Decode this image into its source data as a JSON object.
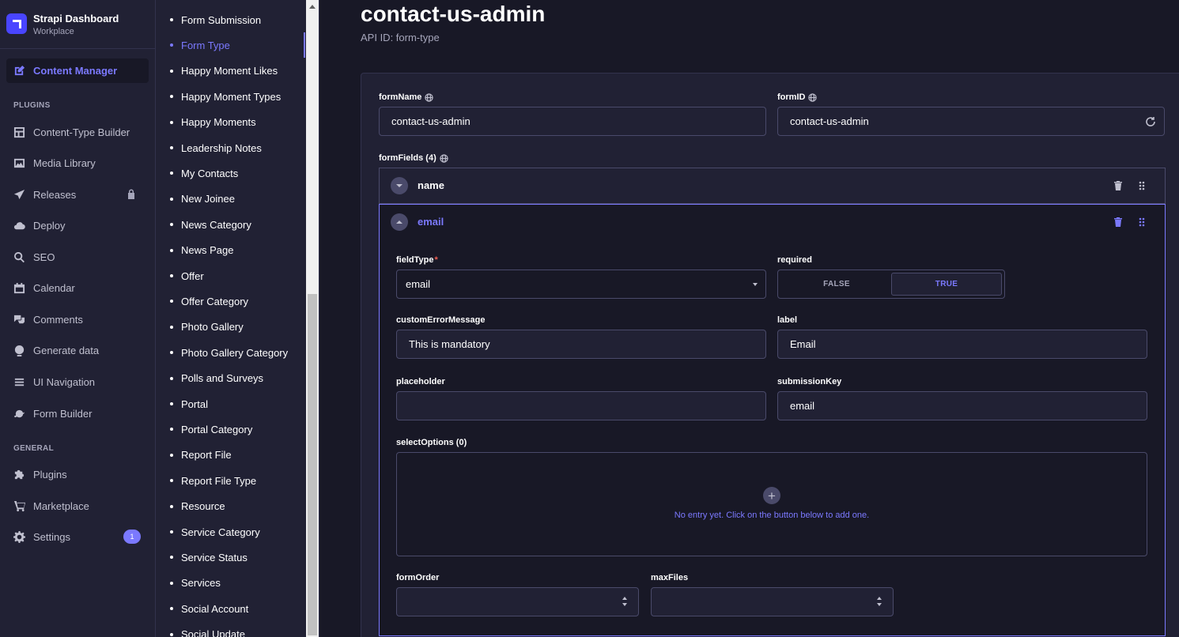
{
  "brand": {
    "title": "Strapi Dashboard",
    "subtitle": "Workplace"
  },
  "nav": {
    "content_manager": "Content Manager",
    "plugins_heading": "PLUGINS",
    "content_type_builder": "Content-Type Builder",
    "media_library": "Media Library",
    "releases": "Releases",
    "deploy": "Deploy",
    "seo": "SEO",
    "calendar": "Calendar",
    "comments": "Comments",
    "generate_data": "Generate data",
    "ui_navigation": "UI Navigation",
    "form_builder": "Form Builder",
    "general_heading": "GENERAL",
    "plugins": "Plugins",
    "marketplace": "Marketplace",
    "settings": "Settings",
    "settings_badge": "1"
  },
  "sub_nav": {
    "items": [
      "Form Submission",
      "Form Type",
      "Happy Moment Likes",
      "Happy Moment Types",
      "Happy Moments",
      "Leadership Notes",
      "My Contacts",
      "New Joinee",
      "News Category",
      "News Page",
      "Offer",
      "Offer Category",
      "Photo Gallery",
      "Photo Gallery Category",
      "Polls and Surveys",
      "Portal",
      "Portal Category",
      "Report File",
      "Report File Type",
      "Resource",
      "Service Category",
      "Service Status",
      "Services",
      "Social Account",
      "Social Update"
    ],
    "active": "Form Type"
  },
  "header": {
    "title": "contact-us-admin",
    "api_id": "API ID: form-type"
  },
  "form": {
    "form_name_label": "formName",
    "form_name_value": "contact-us-admin",
    "form_id_label": "formID",
    "form_id_value": "contact-us-admin",
    "form_fields_label": "formFields (4)",
    "rows": [
      {
        "title": "name"
      },
      {
        "title": "email"
      }
    ],
    "field_type_label": "fieldType",
    "field_type_required_mark": "*",
    "field_type_value": "email",
    "required_label": "required",
    "required_false": "FALSE",
    "required_true": "TRUE",
    "custom_error_label": "customErrorMessage",
    "custom_error_value": "This is mandatory",
    "label_label": "label",
    "label_value": "Email",
    "placeholder_label": "placeholder",
    "placeholder_value": "",
    "submission_key_label": "submissionKey",
    "submission_key_value": "email",
    "select_options_label": "selectOptions (0)",
    "select_options_empty": "No entry yet. Click on the button below to add one.",
    "form_order_label": "formOrder",
    "max_files_label": "maxFiles"
  },
  "colors": {
    "accent": "#7b79ff",
    "background": "#181826",
    "panel": "#212134",
    "border": "#4a4a6a",
    "danger": "#ee5e52"
  }
}
